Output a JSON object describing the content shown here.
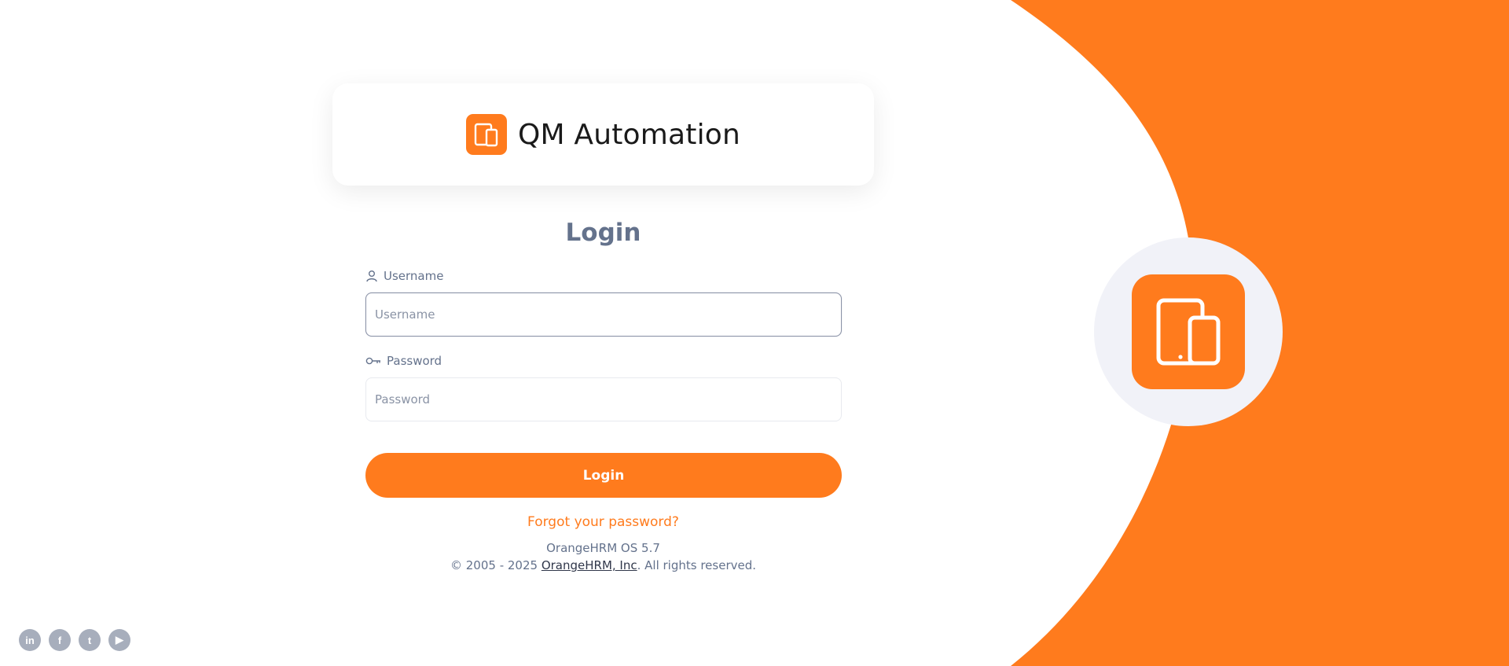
{
  "brand": {
    "name": "QM Automation",
    "logo_icon": "devices-icon",
    "accent": "#ff7b1d"
  },
  "login": {
    "title": "Login",
    "username": {
      "label": "Username",
      "placeholder": "Username",
      "value": "",
      "icon": "user-icon"
    },
    "password": {
      "label": "Password",
      "placeholder": "Password",
      "value": "",
      "icon": "key-icon"
    },
    "submit_label": "Login",
    "forgot_label": "Forgot your password?"
  },
  "footer": {
    "version": "OrangeHRM OS 5.7",
    "copyright_prefix": "© 2005 - 2025 ",
    "company_link": "OrangeHRM, Inc",
    "copyright_suffix": ". All rights reserved."
  },
  "socials": [
    {
      "name": "linkedin-icon",
      "glyph": "in"
    },
    {
      "name": "facebook-icon",
      "glyph": "f"
    },
    {
      "name": "twitter-icon",
      "glyph": "t"
    },
    {
      "name": "youtube-icon",
      "glyph": "▶"
    }
  ],
  "colors": {
    "accent": "#ff7b1d",
    "text": "#64728c",
    "badge_bg": "#f1f2f8"
  }
}
